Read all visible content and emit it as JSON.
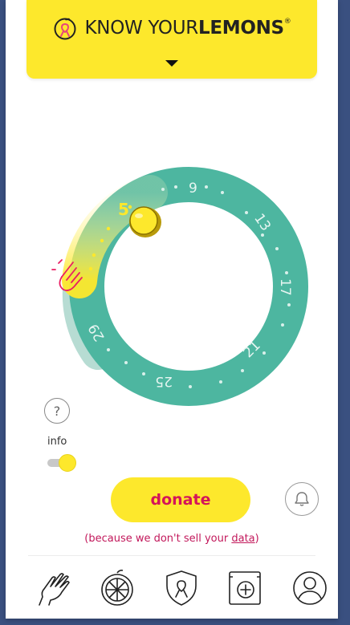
{
  "brand": {
    "name_thin": "KNOW YOUR",
    "name_bold": "LEMONS",
    "registered_mark": "®",
    "icon": "lemon-ribbon-logo-icon",
    "accent_color": "#fde82c"
  },
  "header": {
    "toggle_icon": "triangle-down-icon"
  },
  "cycle_wheel": {
    "labels": [
      "9",
      "13",
      "17",
      "21",
      "25",
      "29"
    ],
    "current_day_label": "5",
    "ring_color": "#4db6a0",
    "highlight_color": "#fde82c",
    "marker_icon": "lemon-marker-icon",
    "drag_icon": "hand-pointer-icon"
  },
  "info": {
    "help_icon": "question-mark-icon",
    "help_symbol": "?",
    "label": "info",
    "toggle_on": true
  },
  "donate": {
    "label": "donate",
    "bell_icon": "bell-icon",
    "tagline_prefix": "(because we don't sell your ",
    "tagline_link": "data",
    "tagline_suffix": ")",
    "text_color": "#d4145a"
  },
  "tabbar": {
    "tabs": [
      {
        "name": "hand-tab",
        "icon": "hand-icon"
      },
      {
        "name": "lemon-tab",
        "icon": "lemon-slice-icon"
      },
      {
        "name": "shield-tab",
        "icon": "shield-ribbon-icon"
      },
      {
        "name": "add-tab",
        "icon": "plus-box-icon"
      },
      {
        "name": "profile-tab",
        "icon": "user-icon"
      }
    ]
  }
}
